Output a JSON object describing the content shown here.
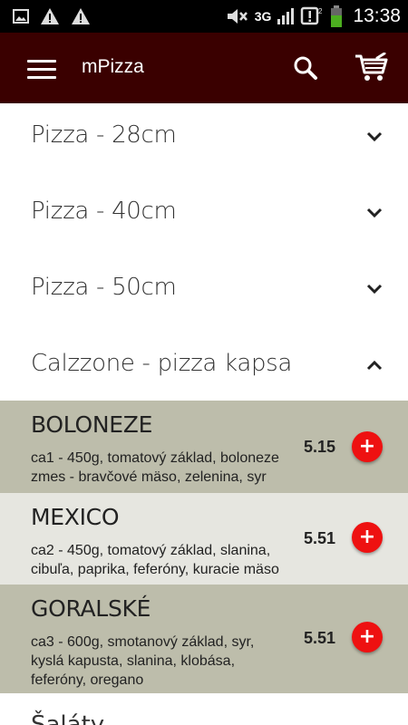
{
  "status_bar": {
    "icons_left": [
      "image-icon",
      "warning-icon",
      "warning-icon"
    ],
    "network": "3G",
    "time": "13:38"
  },
  "app_bar": {
    "title": "mPizza"
  },
  "categories": [
    {
      "label": "Pizza - 28cm",
      "expanded": false
    },
    {
      "label": "Pizza - 40cm",
      "expanded": false
    },
    {
      "label": "Pizza - 50cm",
      "expanded": false
    },
    {
      "label": "Calzzone - pizza kapsa",
      "expanded": true
    }
  ],
  "items": [
    {
      "name": "BOLONEZE",
      "desc_lines": [
        "ca1 - 450g, tomatový základ, boloneze",
        "zmes - bravčové mäso, zelenina, syr"
      ],
      "price": "5.15",
      "bg": "#bdbdab"
    },
    {
      "name": "MEXICO",
      "desc_lines": [
        "ca2 - 450g, tomatový základ, slanina,",
        "cibuľa, paprika, feferóny, kuracie mäso"
      ],
      "price": "5.51",
      "bg": "#e6e6e0"
    },
    {
      "name": "GORALSKÉ",
      "desc_lines": [
        "ca3 - 600g, smotanový základ, syr,",
        "kyslá kapusta, slanina, klobása,",
        "feferóny, oregano"
      ],
      "price": "5.51",
      "bg": "#bdbdab"
    }
  ],
  "next_category": {
    "label": "Šaláty"
  },
  "add_button_label": "+",
  "colors": {
    "app_bar": "#3a0000",
    "add_button": "#ee1111"
  }
}
